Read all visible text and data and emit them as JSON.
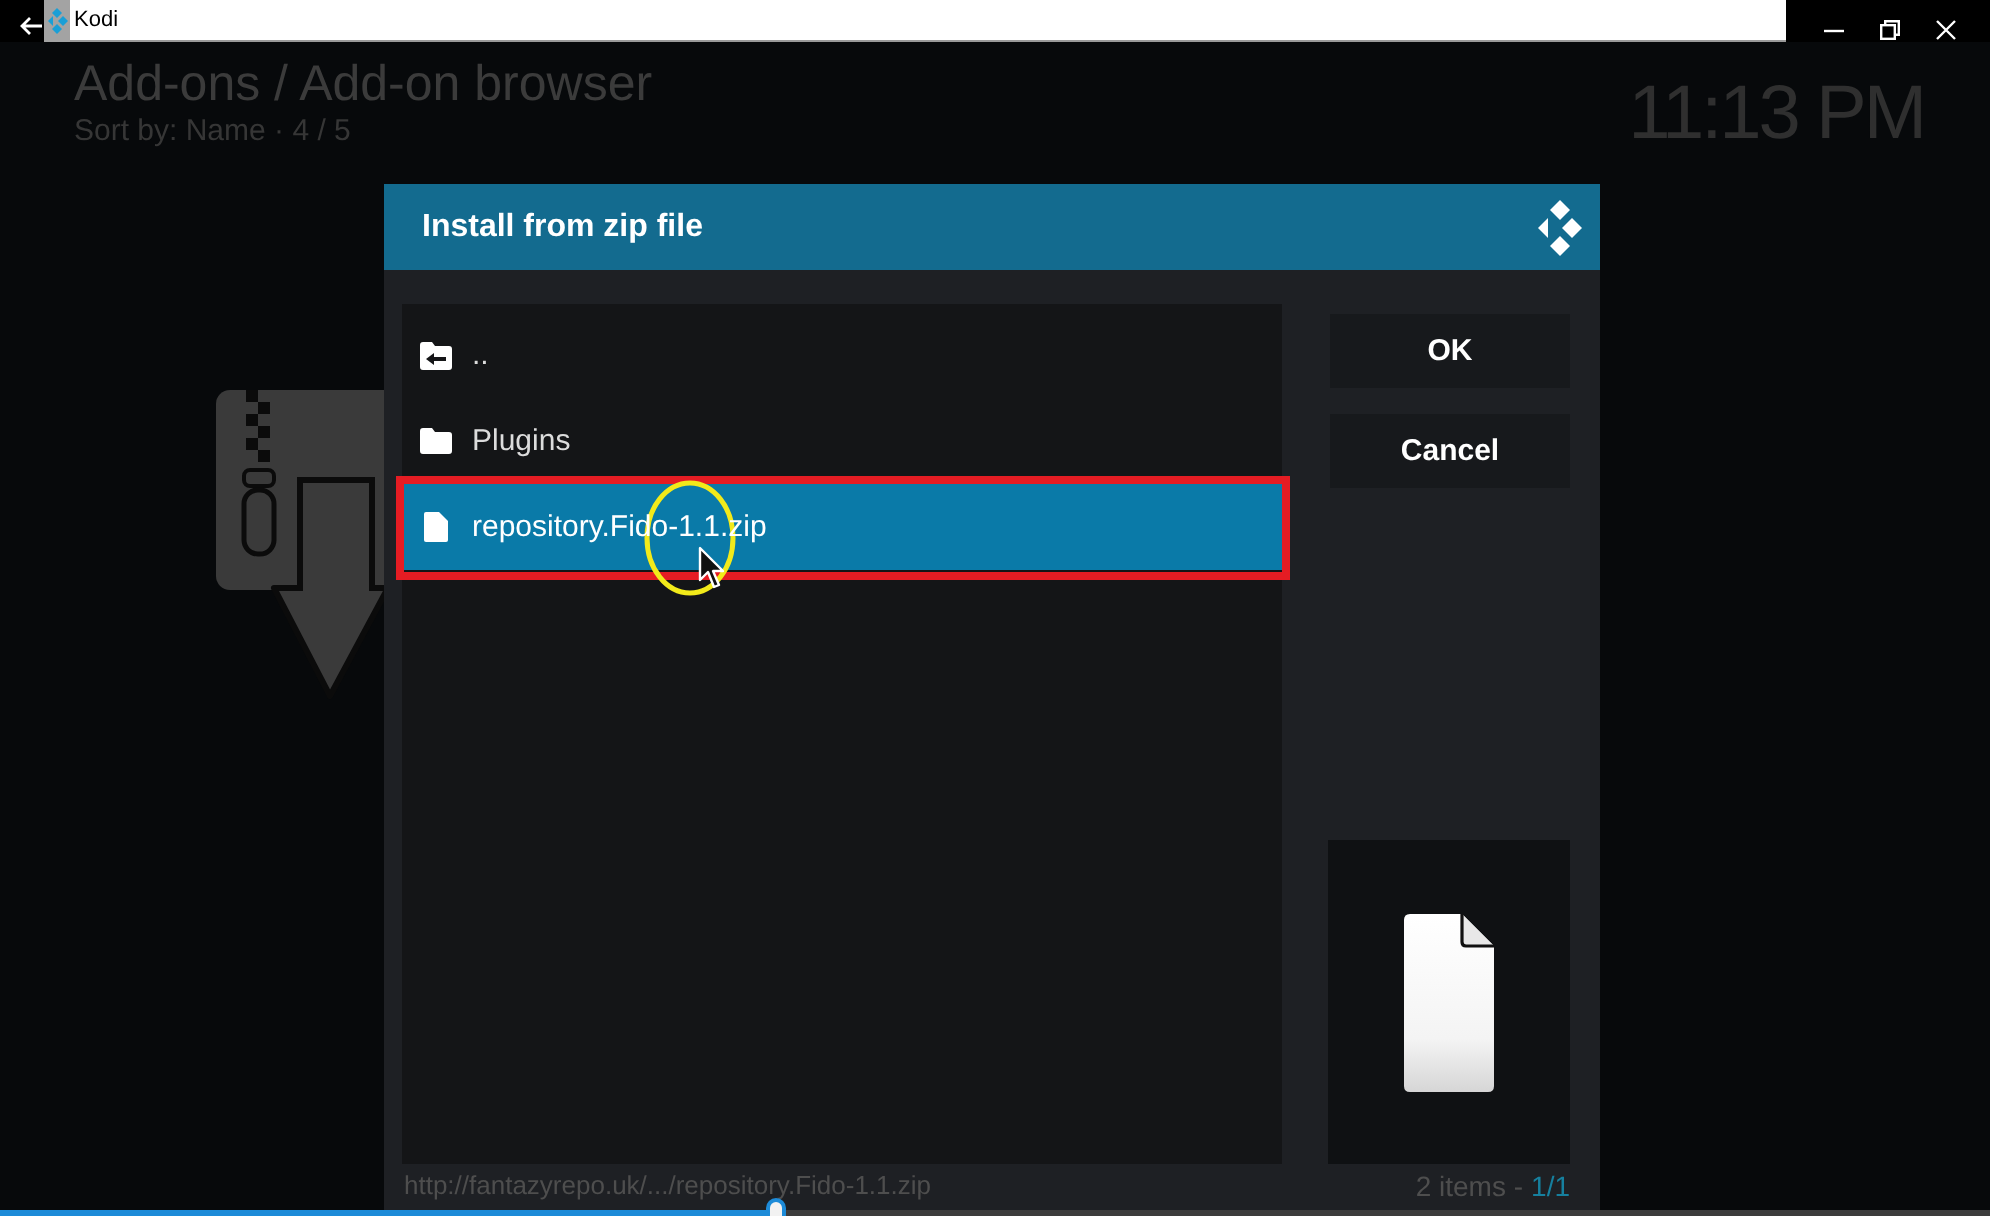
{
  "window": {
    "title": "Kodi"
  },
  "header": {
    "breadcrumb": "Add-ons / Add-on browser",
    "sort": "Sort by: Name · 4 / 5",
    "clock": "11:13 PM"
  },
  "dialog": {
    "title": "Install from zip file",
    "items": [
      {
        "label": "..",
        "kind": "parent",
        "selected": false,
        "highlighted": false
      },
      {
        "label": "Plugins",
        "kind": "folder",
        "selected": false,
        "highlighted": false
      },
      {
        "label": "repository.Fido-1.1.zip",
        "kind": "file",
        "selected": true,
        "highlighted": true
      }
    ],
    "buttons": [
      {
        "label": "OK"
      },
      {
        "label": "Cancel"
      }
    ],
    "path": "http://fantazyrepo.uk/.../repository.Fido-1.1.zip",
    "item_count": "2 items -",
    "page": "1/1"
  },
  "seek_bar": {
    "level": 0.39
  }
}
